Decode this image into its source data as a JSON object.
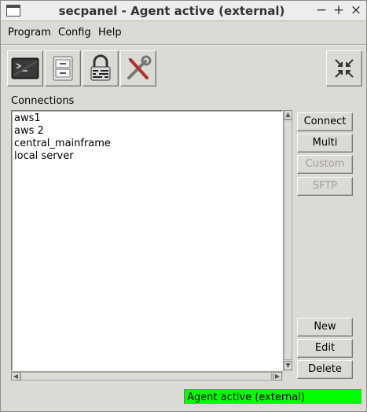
{
  "window": {
    "title": "secpanel - Agent active (external)",
    "controls": {
      "minimize": "−",
      "maximize": "+",
      "close": "×"
    }
  },
  "menubar": {
    "items": [
      {
        "label": "Program"
      },
      {
        "label": "Config"
      },
      {
        "label": "Help"
      }
    ]
  },
  "toolbar": {
    "buttons": [
      {
        "icon": "terminal-icon"
      },
      {
        "icon": "file-cabinet-icon"
      },
      {
        "icon": "padlock-icon"
      },
      {
        "icon": "tools-icon"
      }
    ],
    "collapse_icon": "shrink-arrows-icon"
  },
  "connections": {
    "label": "Connections",
    "items": [
      "aws1",
      "aws 2",
      "central_mainframe",
      "local server"
    ]
  },
  "actions": {
    "connect": "Connect",
    "multi": "Multi",
    "custom": "Custom",
    "sftp": "SFTP",
    "new": "New",
    "edit": "Edit",
    "delete": "Delete"
  },
  "status": {
    "text": "Agent active (external)",
    "color": "#00ff00"
  }
}
